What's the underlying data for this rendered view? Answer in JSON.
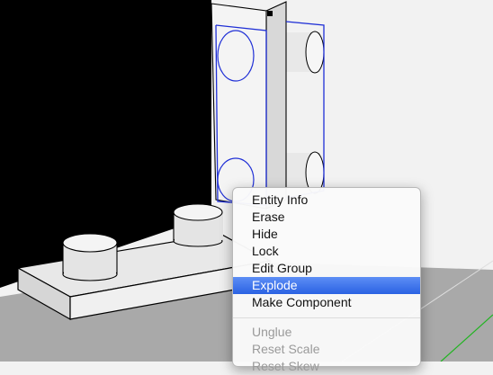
{
  "context_menu": {
    "groups": [
      [
        {
          "label": "Entity Info",
          "enabled": true,
          "highlighted": false
        },
        {
          "label": "Erase",
          "enabled": true,
          "highlighted": false
        },
        {
          "label": "Hide",
          "enabled": true,
          "highlighted": false
        },
        {
          "label": "Lock",
          "enabled": true,
          "highlighted": false
        },
        {
          "label": "Edit Group",
          "enabled": true,
          "highlighted": false
        },
        {
          "label": "Explode",
          "enabled": true,
          "highlighted": true
        },
        {
          "label": "Make Component",
          "enabled": true,
          "highlighted": false
        }
      ],
      [
        {
          "label": "Unglue",
          "enabled": false,
          "highlighted": false
        },
        {
          "label": "Reset Scale",
          "enabled": false,
          "highlighted": false
        },
        {
          "label": "Reset Skew",
          "enabled": false,
          "highlighted": false
        }
      ]
    ]
  },
  "colors": {
    "selection": "#1f2fd6",
    "highlight": "#2f6ae6",
    "axis_green": "#22b422",
    "viewport_bg": "#f2f2f2",
    "dark_wall": "#000000"
  }
}
